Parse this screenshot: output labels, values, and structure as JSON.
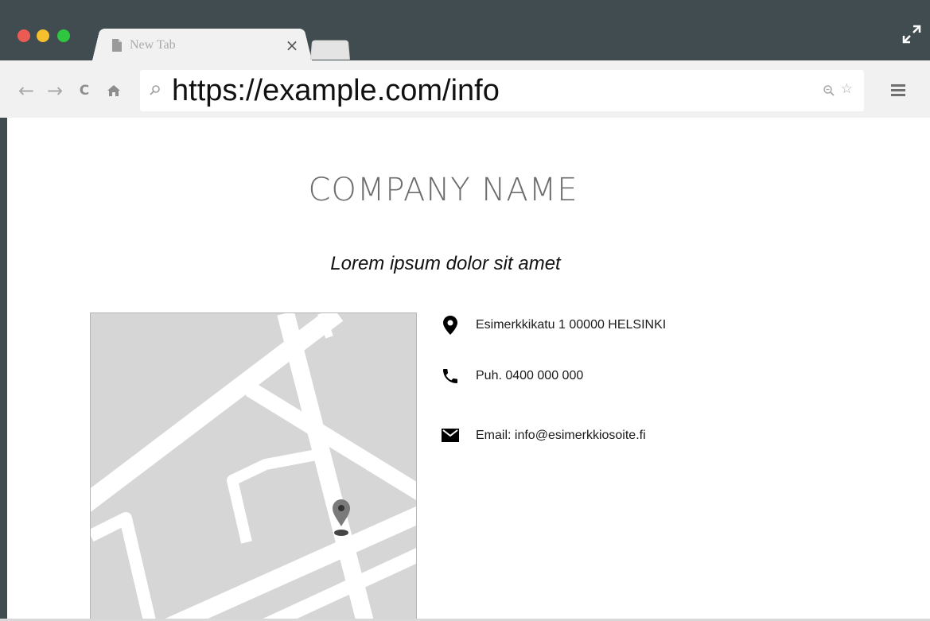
{
  "browser": {
    "tab": {
      "title": "New Tab",
      "close_label": "×"
    },
    "address_bar": {
      "url": "https://example.com/info"
    },
    "icons": {
      "back": "arrow-left-icon",
      "forward": "arrow-right-icon",
      "reload": "reload-icon",
      "home": "home-icon",
      "search": "search-icon",
      "zoom": "zoom-icon",
      "bookmark": "star-icon",
      "menu": "hamburger-menu-icon",
      "fullscreen": "fullscreen-icon"
    },
    "colors": {
      "frame": "#414c50",
      "toolbar": "#f1f1f1",
      "close_dot": "#ec5b53",
      "minimize_dot": "#f5bf2e",
      "maximize_dot": "#2fc73f"
    }
  },
  "page": {
    "company_name": "COMPANY NAME",
    "tagline": "Lorem ipsum dolor sit amet",
    "contact": {
      "address": "Esimerkkikatu 1 00000 HELSINKI",
      "phone": "Puh. 0400 000 000",
      "email": "Email: info@esimerkkiosoite.fi"
    },
    "map": {
      "background": "#d6d6d6",
      "road_color": "#ffffff",
      "pin_color": "#7a7a7a"
    }
  }
}
